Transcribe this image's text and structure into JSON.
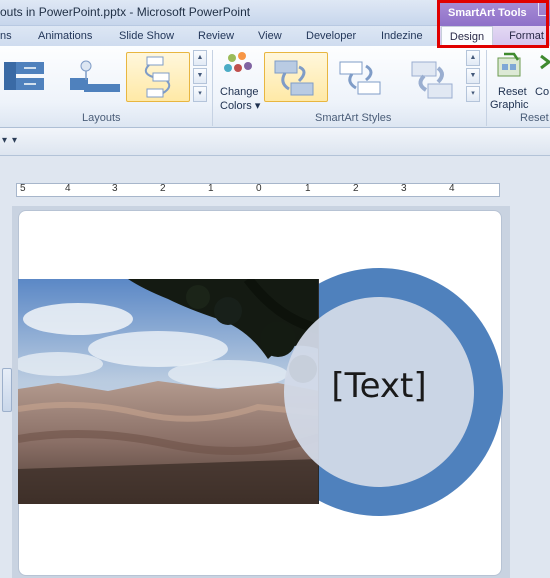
{
  "window": {
    "title": "outs in PowerPoint.pptx  -  Microsoft PowerPoint"
  },
  "contextual_tab_group": {
    "label": "SmartArt Tools"
  },
  "tabs": [
    {
      "label": "ns"
    },
    {
      "label": "Animations"
    },
    {
      "label": "Slide Show"
    },
    {
      "label": "Review"
    },
    {
      "label": "View"
    },
    {
      "label": "Developer"
    },
    {
      "label": "Indezine"
    }
  ],
  "contextual_tabs": [
    {
      "label": "Design",
      "active": true
    },
    {
      "label": "Format",
      "active": false
    }
  ],
  "ribbon": {
    "groups": [
      {
        "label": "Layouts"
      },
      {
        "label": "SmartArt Styles"
      },
      {
        "label": "Reset"
      }
    ],
    "change_colors": {
      "line1": "Change",
      "line2": "Colors ▾"
    },
    "reset_graphic": {
      "line1": "Reset",
      "line2": "Graphic"
    },
    "convert_partial": {
      "line1": "Co"
    }
  },
  "ruler": {
    "labels": [
      "5",
      "4",
      "3",
      "2",
      "1",
      "0",
      "1",
      "2",
      "3",
      "4"
    ]
  },
  "slide": {
    "smartart_text": "[Text]"
  },
  "colors": {
    "accent_ring": "#4f81bd",
    "contextual_tab_header": "#8d6fc8",
    "highlight_box": "#e00000"
  },
  "icons": [
    "layout-list-icon",
    "layout-process-icon",
    "layout-cycle-icon",
    "change-colors-icon",
    "smartart-style-icon",
    "reset-graphic-icon",
    "convert-icon",
    "qat-dropdown-icon",
    "scroll-up-icon",
    "scroll-down-icon",
    "more-icon"
  ]
}
